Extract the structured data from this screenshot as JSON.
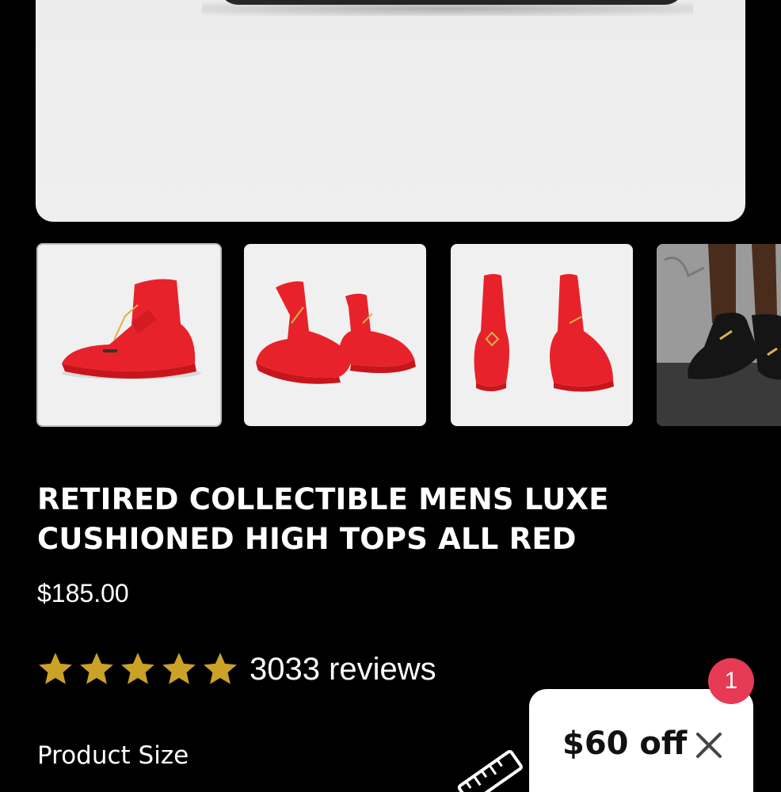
{
  "product": {
    "title_line1": "RETIRED COLLECTIBLE MENS LUXE",
    "title_line2": "CUSHIONED HIGH TOPS ALL RED",
    "price": "$185.00"
  },
  "rating": {
    "stars": 5,
    "max_stars": 5,
    "reviews_text": "3033 reviews",
    "star_color": "#c9a227"
  },
  "size": {
    "label": "Product Size"
  },
  "gallery": {
    "thumbnails": [
      {
        "name": "red-high-top-side-view",
        "selected": true
      },
      {
        "name": "red-high-top-pair-angle",
        "selected": false
      },
      {
        "name": "red-high-top-pair-back",
        "selected": false
      },
      {
        "name": "black-high-top-on-foot",
        "selected": false
      }
    ]
  },
  "promo": {
    "badge_count": "1",
    "offer_text": "$60 off",
    "badge_color": "#e63a55"
  },
  "icons": {
    "ruler": "ruler-icon",
    "close": "close-icon",
    "star": "star-icon"
  }
}
